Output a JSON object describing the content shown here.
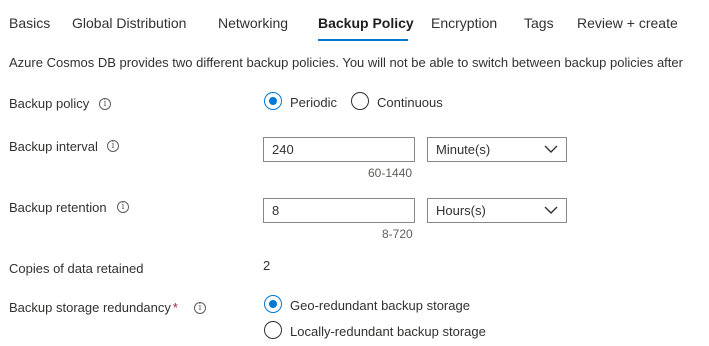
{
  "tabs": [
    {
      "label": "Basics"
    },
    {
      "label": "Global Distribution"
    },
    {
      "label": "Networking"
    },
    {
      "label": "Backup Policy"
    },
    {
      "label": "Encryption"
    },
    {
      "label": "Tags"
    },
    {
      "label": "Review + create"
    }
  ],
  "active_tab": "Backup Policy",
  "description": "Azure Cosmos DB provides two different backup policies. You will not be able to switch between backup policies after",
  "backup_policy": {
    "label": "Backup policy",
    "options": [
      {
        "label": "Periodic",
        "selected": true
      },
      {
        "label": "Continuous",
        "selected": false
      }
    ]
  },
  "backup_interval": {
    "label": "Backup interval",
    "value": "240",
    "unit": "Minute(s)",
    "range": "60-1440"
  },
  "backup_retention": {
    "label": "Backup retention",
    "value": "8",
    "unit": "Hours(s)",
    "range": "8-720"
  },
  "copies": {
    "label": "Copies of data retained",
    "value": "2"
  },
  "storage_redundancy": {
    "label": "Backup storage redundancy",
    "required_marker": "*",
    "options": [
      {
        "label": "Geo-redundant backup storage",
        "selected": true
      },
      {
        "label": "Locally-redundant backup storage",
        "selected": false
      }
    ]
  },
  "colors": {
    "accent": "#0078d4",
    "required": "#a4262c"
  }
}
